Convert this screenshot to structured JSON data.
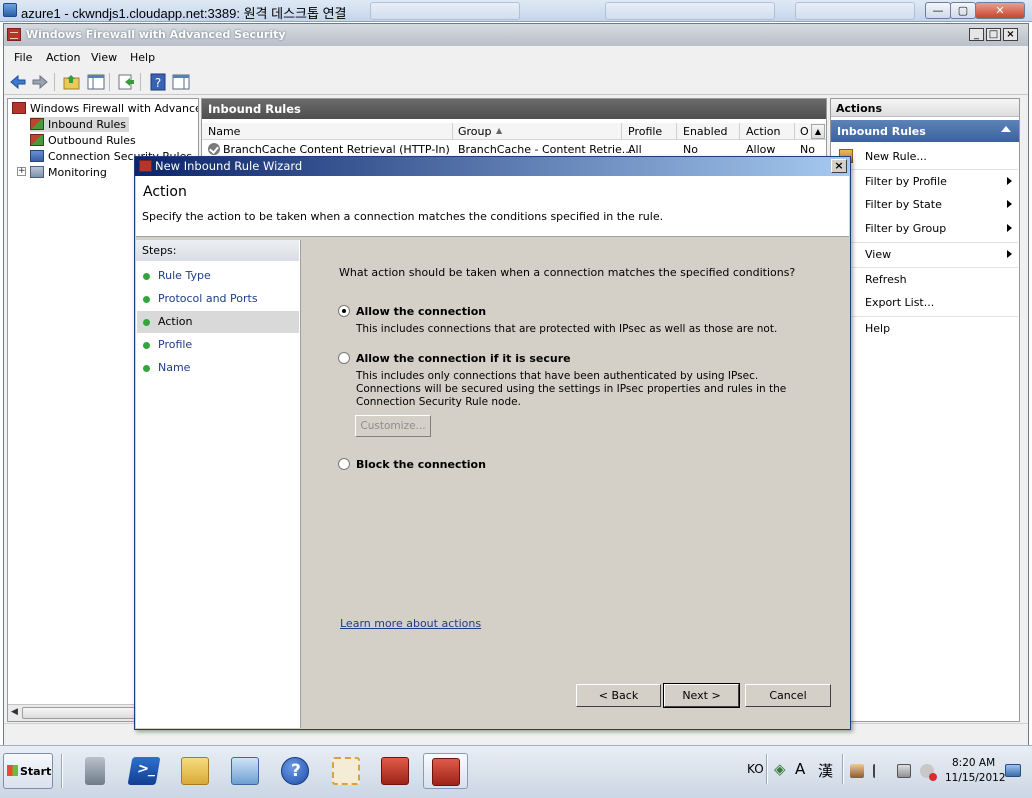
{
  "rdp": {
    "title": "azure1 - ckwndjs1.cloudapp.net:3389: 원격 데스크톱 연결",
    "minimize": "—",
    "restore": "▢",
    "close": "✕"
  },
  "mmc": {
    "title": "Windows Firewall with Advanced Security",
    "menu": [
      "File",
      "Action",
      "View",
      "Help"
    ],
    "tree": {
      "root": "Windows Firewall with Advanced S",
      "items": [
        "Inbound Rules",
        "Outbound Rules",
        "Connection Security Rules",
        "Monitoring"
      ]
    },
    "center": {
      "title": "Inbound Rules",
      "columns": [
        "Name",
        "Group",
        "Profile",
        "Enabled",
        "Action",
        "O"
      ],
      "first_row": {
        "name": "BranchCache Content Retrieval (HTTP-In)",
        "group": "BranchCache - Content Retrie...",
        "profile": "All",
        "enabled": "No",
        "action": "Allow",
        "override": "No"
      }
    },
    "actions": {
      "title": "Actions",
      "section": "Inbound Rules",
      "items": [
        "New Rule...",
        "Filter by Profile",
        "Filter by State",
        "Filter by Group",
        "View",
        "Refresh",
        "Export List...",
        "Help"
      ]
    }
  },
  "wizard": {
    "title": "New Inbound Rule Wizard",
    "heading": "Action",
    "description": "Specify the action to be taken when a connection matches the conditions specified in the rule.",
    "steps_title": "Steps:",
    "steps": [
      "Rule Type",
      "Protocol and Ports",
      "Action",
      "Profile",
      "Name"
    ],
    "current_step": "Action",
    "question": "What action should be taken when a connection matches the specified conditions?",
    "options": [
      {
        "label": "Allow the connection",
        "desc": "This includes connections that are protected with IPsec as well as those are not.",
        "checked": true
      },
      {
        "label": "Allow the connection if it is secure",
        "desc": "This includes only connections that have been authenticated by using IPsec.  Connections will be secured using the settings in IPsec properties and rules in the Connection Security Rule node.",
        "checked": false
      },
      {
        "label": "Block the connection",
        "desc": "",
        "checked": false
      }
    ],
    "customize_label": "Customize...",
    "learn_more": "Learn more about actions",
    "back_label": "< Back",
    "next_label": "Next >",
    "cancel_label": "Cancel"
  },
  "taskbar": {
    "start_label": "Start",
    "language": "KO",
    "ime_a": "A",
    "ime_han": "漢",
    "time": "8:20 AM",
    "date": "11/15/2012"
  }
}
